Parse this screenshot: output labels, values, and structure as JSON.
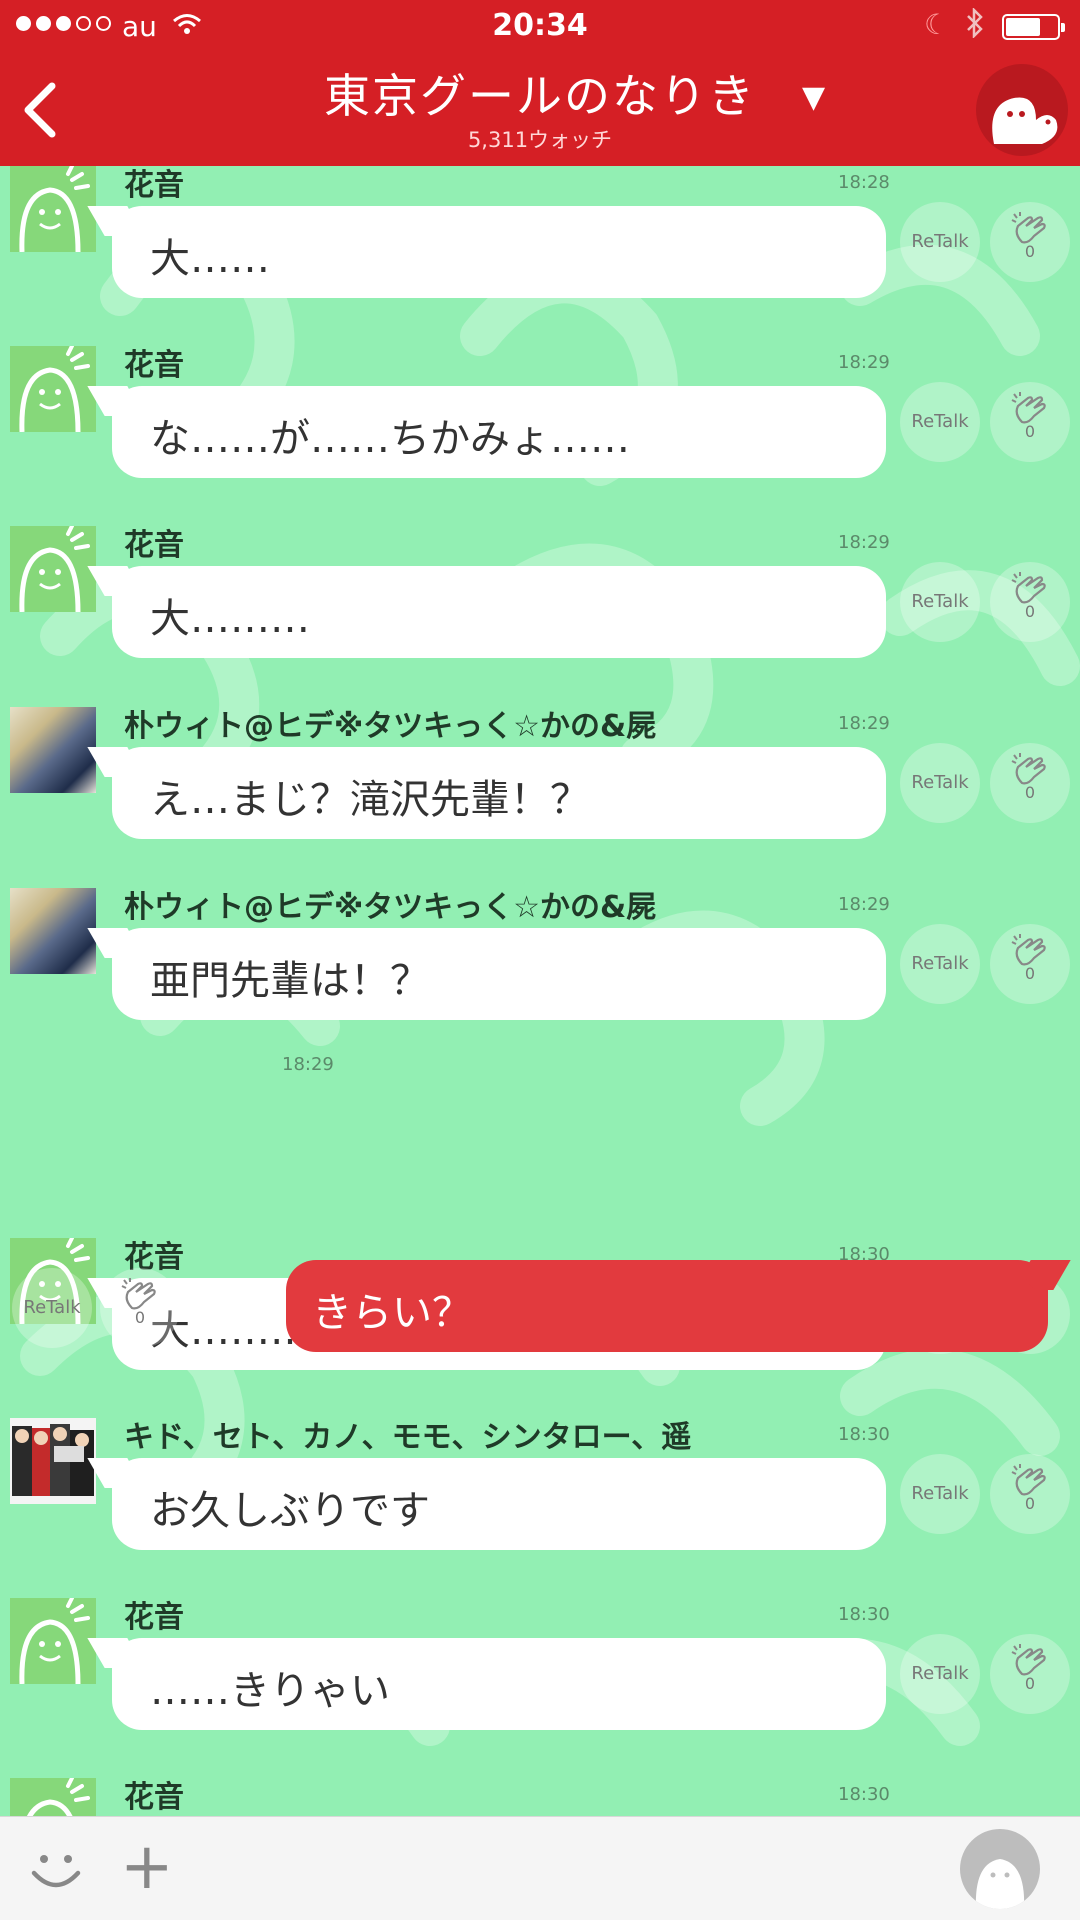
{
  "status": {
    "carrier": "au",
    "time": "20:34"
  },
  "header": {
    "title": "東京グールのなりき",
    "watch_count": "5,311ウォッチ"
  },
  "actions": {
    "retalk_label": "ReTalk"
  },
  "messages": [
    {
      "name": "花音",
      "time": "18:28",
      "text": "大……",
      "likes": "0",
      "avatar": "mascot"
    },
    {
      "name": "花音",
      "time": "18:29",
      "text": "な……が……ちかみょ……",
      "likes": "0",
      "avatar": "mascot"
    },
    {
      "name": "花音",
      "time": "18:29",
      "text": "大………",
      "likes": "0",
      "avatar": "mascot"
    },
    {
      "name": "朴ウィト@ヒデ※タツキっく☆かの&屍",
      "time": "18:29",
      "text": "え…まじ？滝沢先輩！？",
      "likes": "0",
      "avatar": "photo1"
    },
    {
      "name": "朴ウィト@ヒデ※タツキっく☆かの&屍",
      "time": "18:29",
      "text": "亜門先輩は！？",
      "likes": "0",
      "avatar": "photo1"
    },
    {
      "name": "花音",
      "time": "18:30",
      "text": "大………",
      "likes": "0",
      "avatar": "mascot"
    },
    {
      "name": "キド、セト、カノ、モモ、シンタロー、遥",
      "time": "18:30",
      "text": "お久しぶりです",
      "likes": "0",
      "avatar": "photo2"
    },
    {
      "name": "花音",
      "time": "18:30",
      "text": "……きりゃい",
      "likes": "0",
      "avatar": "mascot"
    },
    {
      "name": "花音",
      "time": "18:30",
      "text": "",
      "likes": "",
      "avatar": "mascot"
    }
  ],
  "own_message": {
    "time": "18:29",
    "text": "きらい？",
    "likes": "0"
  },
  "colors": {
    "header": "#d51f25",
    "own_bubble": "#e23a3e",
    "background": "#92efb3"
  }
}
